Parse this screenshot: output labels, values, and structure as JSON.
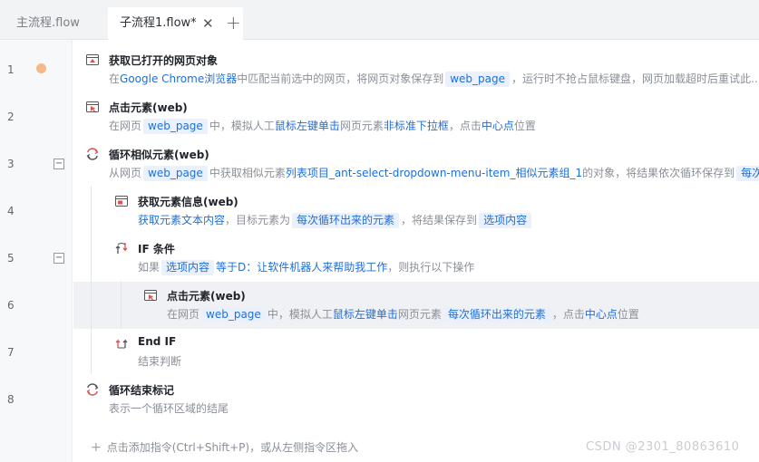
{
  "tabs": [
    {
      "label": "主流程.flow"
    },
    {
      "label": "子流程1.flow*"
    }
  ],
  "tab_close": "✕",
  "tab_add": "+",
  "line_numbers": [
    "1",
    "2",
    "3",
    "4",
    "5",
    "6",
    "7",
    "8"
  ],
  "fold_symbol": "−",
  "steps": {
    "s1": {
      "title": "获取已打开的网页对象",
      "d": [
        "在",
        "Google Chrome浏览器",
        "中匹配当前选中的网页，将网页对象保存到",
        "web_page",
        "，运行时不抢占鼠标键盘，网页加载超时后重试此..."
      ]
    },
    "s2": {
      "title": "点击元素(web)",
      "d": [
        "在网页",
        "web_page",
        "中，模拟人工",
        "鼠标左键单击",
        "网页元素",
        "非标准下拉框",
        "，点击",
        "中心点",
        "位置"
      ]
    },
    "s3": {
      "title": "循环相似元素(web)",
      "d": [
        "从网页",
        "web_page",
        "中获取相似元素",
        "列表项目_ant-select-dropdown-menu-item_相似元素组_1",
        "的对象，将结果依次循环保存到",
        "每次循"
      ]
    },
    "s4": {
      "title": "获取元素信息(web)",
      "d": [
        "获取元素文本内容",
        "，目标元素为",
        "每次循环出来的元素",
        "，将结果保存到",
        "选项内容"
      ]
    },
    "s5": {
      "title": "IF 条件",
      "d": [
        "如果",
        "选项内容",
        "等于D：让软件机器人来帮助我工作",
        "，则执行以下操作"
      ]
    },
    "s6": {
      "title": "点击元素(web)",
      "d": [
        "在网页",
        "web_page",
        "中，模拟人工",
        "鼠标左键单击",
        "网页元素",
        "每次循环出来的元素",
        "，点击",
        "中心点",
        "位置"
      ]
    },
    "s7": {
      "title": "End IF",
      "d": [
        "结束判断"
      ]
    },
    "s8": {
      "title": "循环结束标记",
      "d": [
        "表示一个循环区域的结尾"
      ]
    }
  },
  "footer_add": "点击添加指令(Ctrl+Shift+P)，或从左侧指令区拖入",
  "footer_plus": "+",
  "watermark": "CSDN @2301_80863610",
  "colors": {
    "accent": "#1e6fd9",
    "chip_bg": "#eaf1fc",
    "breakpoint": "#f6b88a",
    "icon_red": "#d9534f"
  }
}
